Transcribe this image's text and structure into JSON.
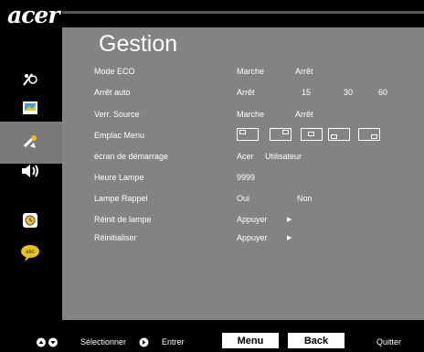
{
  "brand": "acer",
  "menu_title": "Gestion",
  "rows": [
    {
      "label": "Mode ECO"
    },
    {
      "label": "Arrêt auto"
    },
    {
      "label": "Verr. Source"
    },
    {
      "label": "Emplac Menu"
    },
    {
      "label": "écran de démarrage"
    },
    {
      "label": "Heure Lampe"
    },
    {
      "label": "Lampe Rappel"
    },
    {
      "label": "Réinit de lampe"
    },
    {
      "label": "Réinitialiser"
    }
  ],
  "values": {
    "eco_on": "Marche",
    "eco_off": "Arrêt",
    "auto_off": "Arrêt",
    "auto_15": "15",
    "auto_30": "30",
    "auto_60": "60",
    "lock_on": "Marche",
    "lock_off": "Arrêt",
    "start_acer": "Acer",
    "start_user": "Utilisateur",
    "lamp_hours": "9999",
    "reminder_yes": "Oui",
    "reminder_no": "Non",
    "reset_lamp": "Appuyer",
    "reset_all": "Appuyer"
  },
  "sidebar_icons": [
    "picture-settings-icon",
    "image-icon",
    "management-icon",
    "audio-icon",
    "timer-icon",
    "language-icon"
  ],
  "footer": {
    "select_label": "Sélectionner",
    "enter_label": "Entrer",
    "menu_button": "Menu",
    "back_button": "Back",
    "quit_label": "Quitter"
  },
  "colors": {
    "panel": "#838383",
    "background": "#000000",
    "text": "#ffffff"
  }
}
